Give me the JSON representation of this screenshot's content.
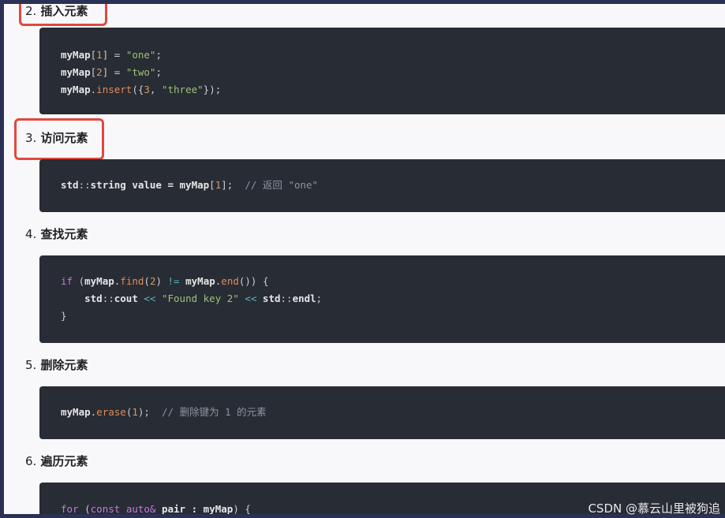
{
  "sections": [
    {
      "number": "2.",
      "title": "插入元素"
    },
    {
      "number": "3.",
      "title": "访问元素"
    },
    {
      "number": "4.",
      "title": "查找元素"
    },
    {
      "number": "5.",
      "title": "删除元素"
    },
    {
      "number": "6.",
      "title": "遍历元素"
    }
  ],
  "code": {
    "insert": [
      [
        "myMap",
        "[",
        "1",
        "] = ",
        "\"one\"",
        ";"
      ],
      [
        "myMap",
        "[",
        "2",
        "] = ",
        "\"two\"",
        ";"
      ],
      [
        "myMap",
        ".",
        "insert",
        "({",
        "3",
        ", ",
        "\"three\"",
        "});"
      ]
    ],
    "access": [
      "std",
      "::",
      "string",
      " value = ",
      "myMap",
      "[",
      "1",
      "];",
      "  // 返回 \"one\""
    ],
    "find": [
      [
        "if",
        " (",
        "myMap",
        ".",
        "find",
        "(",
        "2",
        ") ",
        "!=",
        " ",
        "myMap",
        ".",
        "end",
        "()) {"
      ],
      [
        "    std",
        "::",
        "cout",
        " << ",
        "\"Found key 2\"",
        " << ",
        "std",
        "::",
        "endl",
        ";"
      ],
      [
        "}"
      ]
    ],
    "erase": [
      "myMap",
      ".",
      "erase",
      "(",
      "1",
      ");",
      "  // 删除键为 1 的元素"
    ],
    "iterate": [
      "for",
      " (",
      "const",
      " ",
      "auto",
      "&",
      " pair : ",
      "myMap",
      ") {"
    ]
  },
  "watermark": "CSDN @慕云山里被狗追",
  "colors": {
    "highlight": "#e0483e",
    "code_bg": "#282c34",
    "page_bg": "#f8f8fa",
    "border": "#2b3154"
  }
}
